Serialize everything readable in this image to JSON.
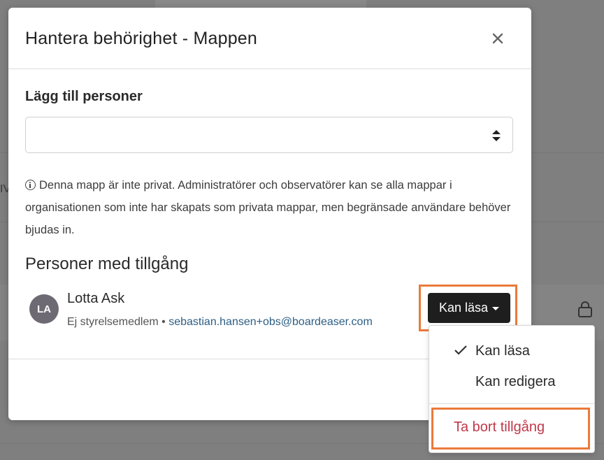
{
  "background": {
    "edge_text": "IV"
  },
  "modal": {
    "title": "Hantera behörighet - Mappen",
    "close_label": "×",
    "add_people_label": "Lägg till personer",
    "add_people_value": "",
    "info_text": "Denna mapp är inte privat. Administratörer och observatörer kan se alla mappar i organisationen som inte har skapats som privata mappar, men begränsade användare behöver bjudas in.",
    "people_heading": "Personer med tillgång",
    "people": [
      {
        "initials": "LA",
        "name": "Lotta Ask",
        "role": "Ej styrelsemedlem",
        "separator": "•",
        "email": "sebastian.hansen+obs@boardeaser.com",
        "permission": "Kan läsa"
      }
    ]
  },
  "permission_menu": {
    "options": [
      {
        "label": "Kan läsa",
        "selected": true
      },
      {
        "label": "Kan redigera",
        "selected": false
      }
    ],
    "remove_label": "Ta bort tillgång"
  },
  "colors": {
    "highlight": "#ea7a3a",
    "danger": "#c0384a",
    "link": "#2c5e84",
    "button_dark": "#1e1e1e"
  }
}
